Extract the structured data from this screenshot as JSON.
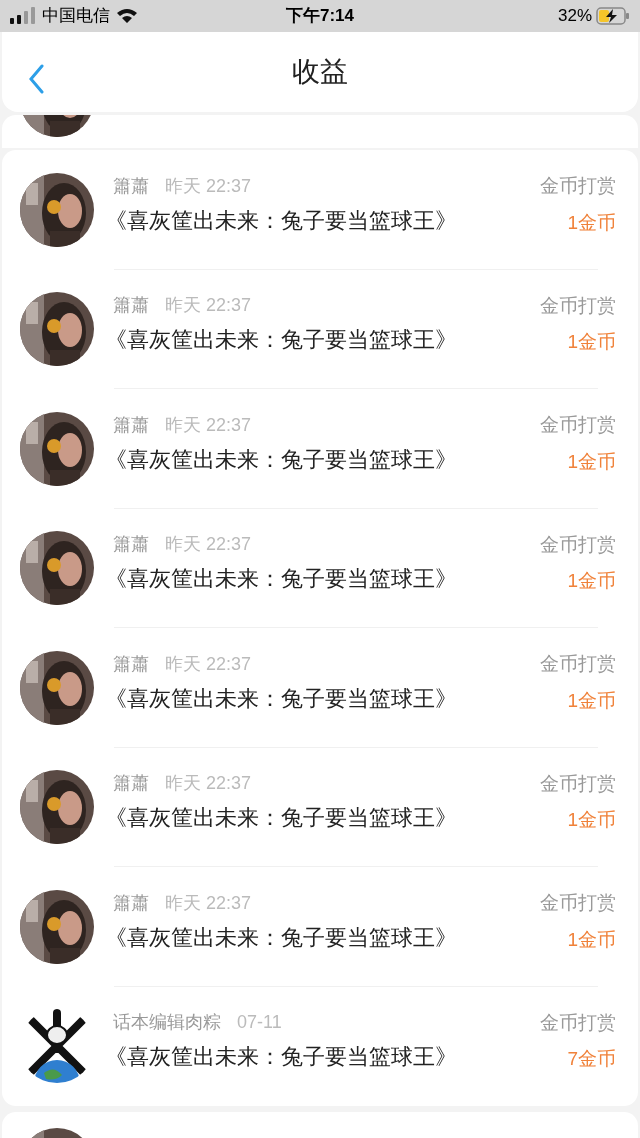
{
  "status_bar": {
    "carrier": "中国电信",
    "time": "下午7:14",
    "battery": "32%"
  },
  "header": {
    "title": "收益"
  },
  "items": [
    {
      "user": "簫蕭",
      "time": "昨天 22:37",
      "work": "《喜灰筐出未来：兔子要当篮球王》",
      "type": "金币打赏",
      "amount": "1金币"
    },
    {
      "user": "簫蕭",
      "time": "昨天 22:37",
      "work": "《喜灰筐出未来：兔子要当篮球王》",
      "type": "金币打赏",
      "amount": "1金币"
    },
    {
      "user": "簫蕭",
      "time": "昨天 22:37",
      "work": "《喜灰筐出未来：兔子要当篮球王》",
      "type": "金币打赏",
      "amount": "1金币"
    },
    {
      "user": "簫蕭",
      "time": "昨天 22:37",
      "work": "《喜灰筐出未来：兔子要当篮球王》",
      "type": "金币打赏",
      "amount": "1金币"
    },
    {
      "user": "簫蕭",
      "time": "昨天 22:37",
      "work": "《喜灰筐出未来：兔子要当篮球王》",
      "type": "金币打赏",
      "amount": "1金币"
    },
    {
      "user": "簫蕭",
      "time": "昨天 22:37",
      "work": "《喜灰筐出未来：兔子要当篮球王》",
      "type": "金币打赏",
      "amount": "1金币"
    },
    {
      "user": "簫蕭",
      "time": "昨天 22:37",
      "work": "《喜灰筐出未来：兔子要当篮球王》",
      "type": "金币打赏",
      "amount": "1金币"
    },
    {
      "user": "话本编辑肉粽",
      "time": "07-11",
      "work": "《喜灰筐出未来：兔子要当篮球王》",
      "type": "金币打赏",
      "amount": "7金币"
    }
  ]
}
